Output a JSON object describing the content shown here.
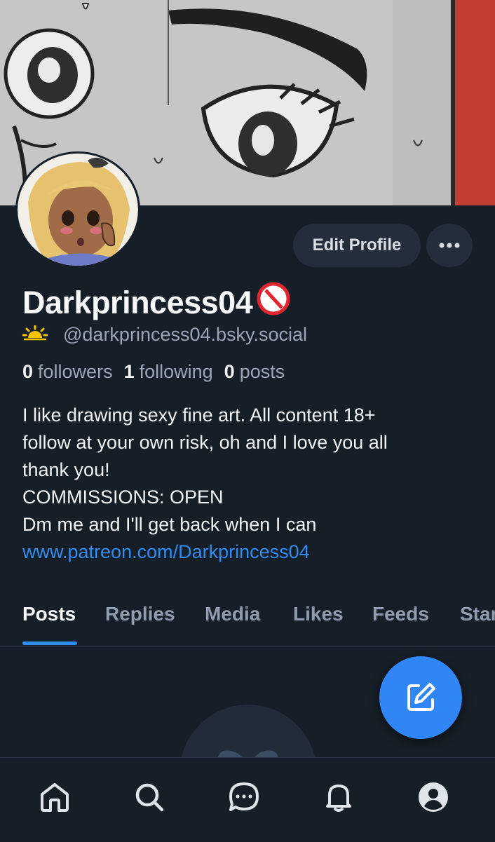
{
  "header": {
    "banner": "banner-image",
    "avatar": "avatar-image"
  },
  "actions": {
    "edit_profile_label": "Edit Profile",
    "more_icon": "ellipsis-icon"
  },
  "profile": {
    "display_name": "Darkprincess04",
    "name_badge": "no-18-emoji",
    "handle_icon": "sun-icon",
    "handle": "@darkprincess04.bsky.social",
    "stats": [
      {
        "count": "0",
        "label": "followers"
      },
      {
        "count": "1",
        "label": "following"
      },
      {
        "count": "0",
        "label": "posts"
      }
    ],
    "bio_lines": [
      "I like drawing sexy fine art. All content 18+",
      "follow at your own risk, oh and I love you all",
      "thank you!",
      "COMMISSIONS: OPEN",
      "Dm me and I'll get back when I can"
    ],
    "bio_link": "www.patreon.com/Darkprincess04"
  },
  "tabs": [
    {
      "label": "Posts",
      "active": true
    },
    {
      "label": "Replies",
      "active": false
    },
    {
      "label": "Media",
      "active": false
    },
    {
      "label": "Likes",
      "active": false
    },
    {
      "label": "Feeds",
      "active": false
    },
    {
      "label": "Starter Packs",
      "active": false
    }
  ],
  "fab": {
    "icon": "compose-icon"
  },
  "bottom_nav": [
    {
      "icon": "home-icon"
    },
    {
      "icon": "search-icon"
    },
    {
      "icon": "chat-icon"
    },
    {
      "icon": "bell-icon"
    },
    {
      "icon": "profile-icon"
    }
  ],
  "colors": {
    "background": "#161e27",
    "accent": "#2f8cf0",
    "button_bg": "#242e3b",
    "muted_text": "#9aa6b5"
  }
}
